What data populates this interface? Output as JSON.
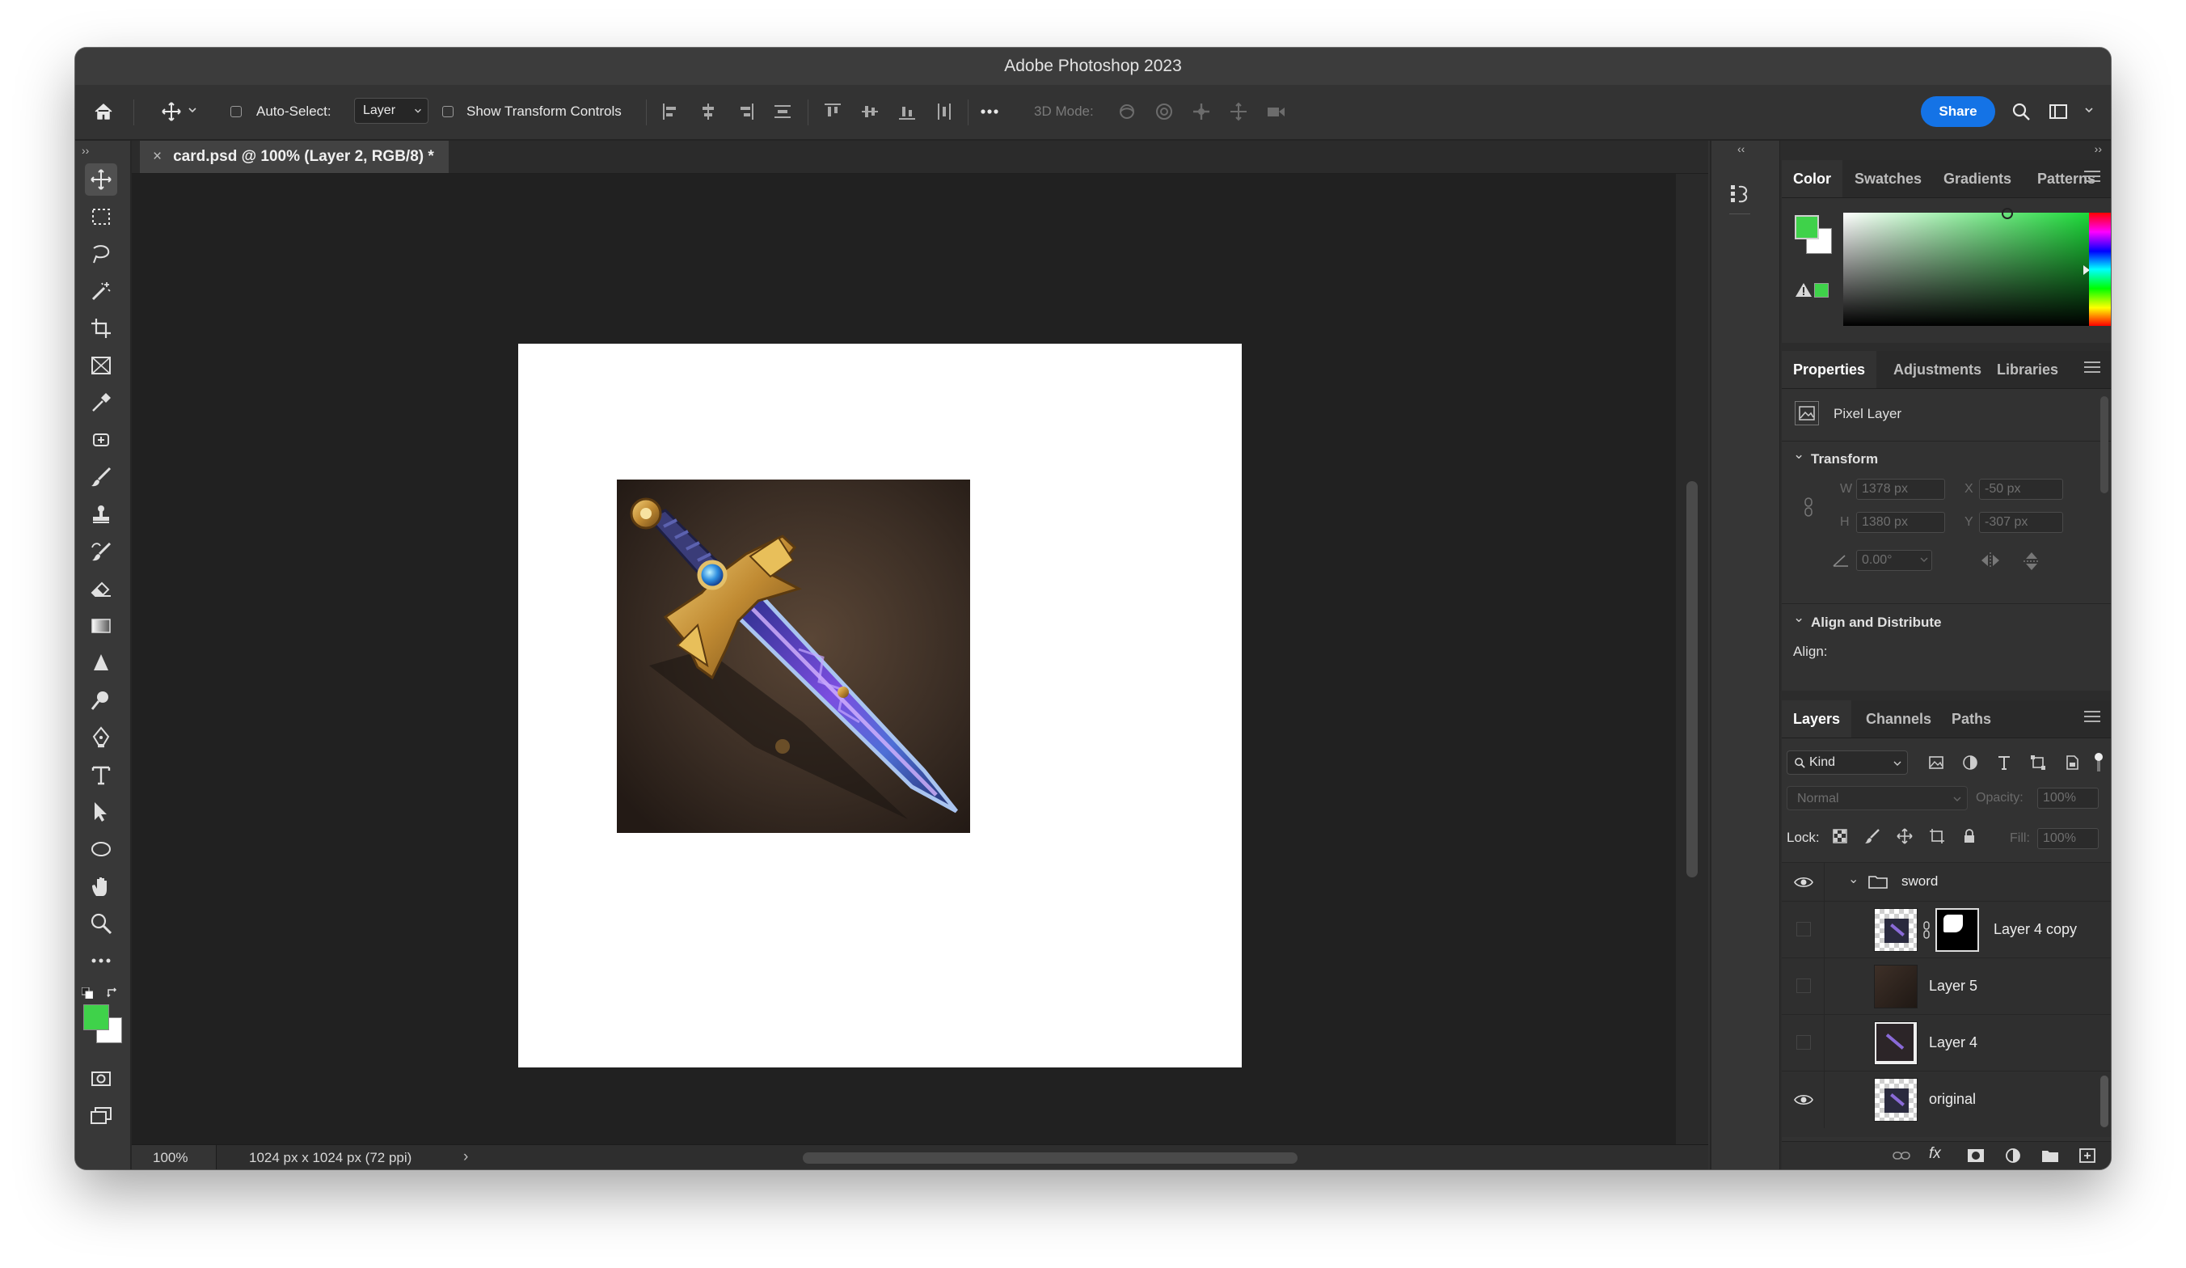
{
  "window": {
    "title": "Adobe Photoshop 2023"
  },
  "options_bar": {
    "auto_select_label": "Auto-Select:",
    "auto_select_value": "Layer",
    "show_transform_label": "Show Transform Controls",
    "mode_3d_label": "3D Mode:",
    "share_label": "Share"
  },
  "document": {
    "tab_title": "card.psd @ 100% (Layer 2, RGB/8) *",
    "zoom": "100%",
    "size_info": "1024 px x 1024 px (72 ppi)"
  },
  "color_panel": {
    "tabs": [
      "Color",
      "Swatches",
      "Gradients",
      "Patterns"
    ],
    "foreground": "#3fd24a",
    "background": "#ffffff"
  },
  "properties_panel": {
    "tabs": [
      "Properties",
      "Adjustments",
      "Libraries"
    ],
    "layer_type": "Pixel Layer",
    "transform_title": "Transform",
    "w_label": "W",
    "w_value": "1378 px",
    "h_label": "H",
    "h_value": "1380 px",
    "x_label": "X",
    "x_value": "-50 px",
    "y_label": "Y",
    "y_value": "-307 px",
    "angle_value": "0.00°",
    "align_title": "Align and Distribute",
    "align_label": "Align:"
  },
  "layers_panel": {
    "tabs": [
      "Layers",
      "Channels",
      "Paths"
    ],
    "filter_label": "Kind",
    "blend_mode": "Normal",
    "opacity_label": "Opacity:",
    "opacity_value": "100%",
    "lock_label": "Lock:",
    "fill_label": "Fill:",
    "fill_value": "100%",
    "group_name": "sword",
    "layers": [
      {
        "name": "Layer 4 copy",
        "visible": false
      },
      {
        "name": "Layer 5",
        "visible": false
      },
      {
        "name": "Layer 4",
        "visible": false
      },
      {
        "name": "original",
        "visible": true
      }
    ]
  }
}
